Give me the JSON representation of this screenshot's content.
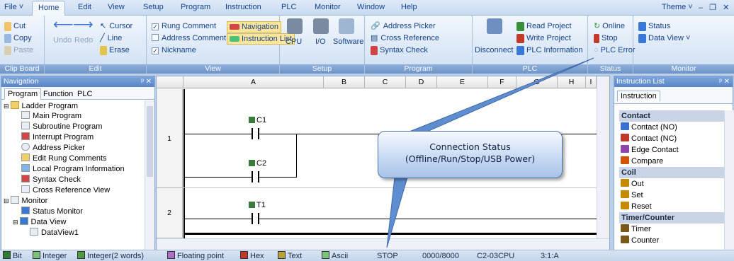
{
  "menubar": {
    "items": [
      "File ˅",
      "Home",
      "Edit",
      "View",
      "Setup",
      "Program",
      "Instruction",
      "PLC",
      "Monitor",
      "Window",
      "Help"
    ],
    "theme": "Theme  ˅",
    "window_controls": "‒ ❐ ✕"
  },
  "ribbon": {
    "clipboard": {
      "cut": "Cut",
      "copy": "Copy",
      "paste": "Paste",
      "label": "Clip Board"
    },
    "edit": {
      "undo": "Undo",
      "redo": "Redo",
      "cursor": "Cursor",
      "line": "Line",
      "erase": "Erase",
      "label": "Edit"
    },
    "view": {
      "rung_comment": "Rung Comment",
      "address_comment": "Address Comment",
      "nickname": "Nickname",
      "navigation": "Navigation",
      "instruction_list": "Instruction List",
      "label": "View"
    },
    "setup": {
      "cpu": "CPU",
      "io": "I/O",
      "software": "Software",
      "label": "Setup"
    },
    "program": {
      "address_picker": "Address Picker",
      "cross_reference": "Cross Reference",
      "syntax_check": "Syntax Check",
      "label": "Program"
    },
    "plc": {
      "disconnect": "Disconnect",
      "read_project": "Read Project",
      "write_project": "Write Project",
      "plc_information": "PLC Information",
      "label": "PLC"
    },
    "status": {
      "online": "Online",
      "stop": "Stop",
      "plc_error": "PLC Error",
      "label": "Status"
    },
    "monitor": {
      "status": "Status",
      "data_view": "Data View ˅",
      "label": "Monitor"
    }
  },
  "navigation": {
    "title": "Navigation",
    "pin": "ᵖ ✕",
    "tabs": [
      "Program",
      "Function",
      "PLC"
    ],
    "tree": [
      "Ladder Program",
      "Main Program",
      "Subroutine Program",
      "Interrupt Program",
      "Address Picker",
      "Edit Rung Comments",
      "Local Program Information",
      "Syntax Check",
      "Cross Reference View",
      "Monitor",
      "Status Monitor",
      "Data View",
      "DataView1"
    ]
  },
  "editor": {
    "columns": [
      "A",
      "B",
      "C",
      "D",
      "E",
      "F",
      "G",
      "H",
      "I"
    ],
    "rows": [
      "1",
      "2"
    ],
    "contacts": [
      "C1",
      "C2",
      "T1"
    ]
  },
  "instruction_list": {
    "title": "Instruction List",
    "pin": "ᵖ ✕",
    "tab": "Instruction",
    "items": [
      {
        "text": "Contact",
        "category": true,
        "color": ""
      },
      {
        "text": "Contact (NO)",
        "category": false,
        "color": "#3b6fd1"
      },
      {
        "text": "Contact (NC)",
        "category": false,
        "color": "#c0392b"
      },
      {
        "text": "Edge Contact",
        "category": false,
        "color": "#8e44ad"
      },
      {
        "text": "Compare",
        "category": false,
        "color": "#d35400"
      },
      {
        "text": "Coil",
        "category": true,
        "color": ""
      },
      {
        "text": "Out",
        "category": false,
        "color": "#c58a00"
      },
      {
        "text": "Set",
        "category": false,
        "color": "#c58a00"
      },
      {
        "text": "Reset",
        "category": false,
        "color": "#c58a00"
      },
      {
        "text": "Timer/Counter",
        "category": true,
        "color": ""
      },
      {
        "text": "Timer",
        "category": false,
        "color": "#7a5a1a"
      },
      {
        "text": "Counter",
        "category": false,
        "color": "#7a5a1a"
      }
    ]
  },
  "statusbar": {
    "bit": "Bit",
    "integer": "Integer",
    "integer2": "Integer(2 words)",
    "float": "Floating point",
    "hex": "Hex",
    "text": "Text",
    "ascii": "Ascii",
    "mode": "STOP",
    "memory": "0000/8000",
    "cpu": "C2-03CPU",
    "position": "3:1:A"
  },
  "callout": {
    "line1": "Connection Status",
    "line2": "(Offline/Run/Stop/USB Power)"
  },
  "colors": {
    "accent": "#15428b",
    "ribbon_label": "#6f93c6",
    "callout_border": "#4b74b5",
    "stop_icon": "#c0392b",
    "online_icon": "#2e9e3a"
  }
}
